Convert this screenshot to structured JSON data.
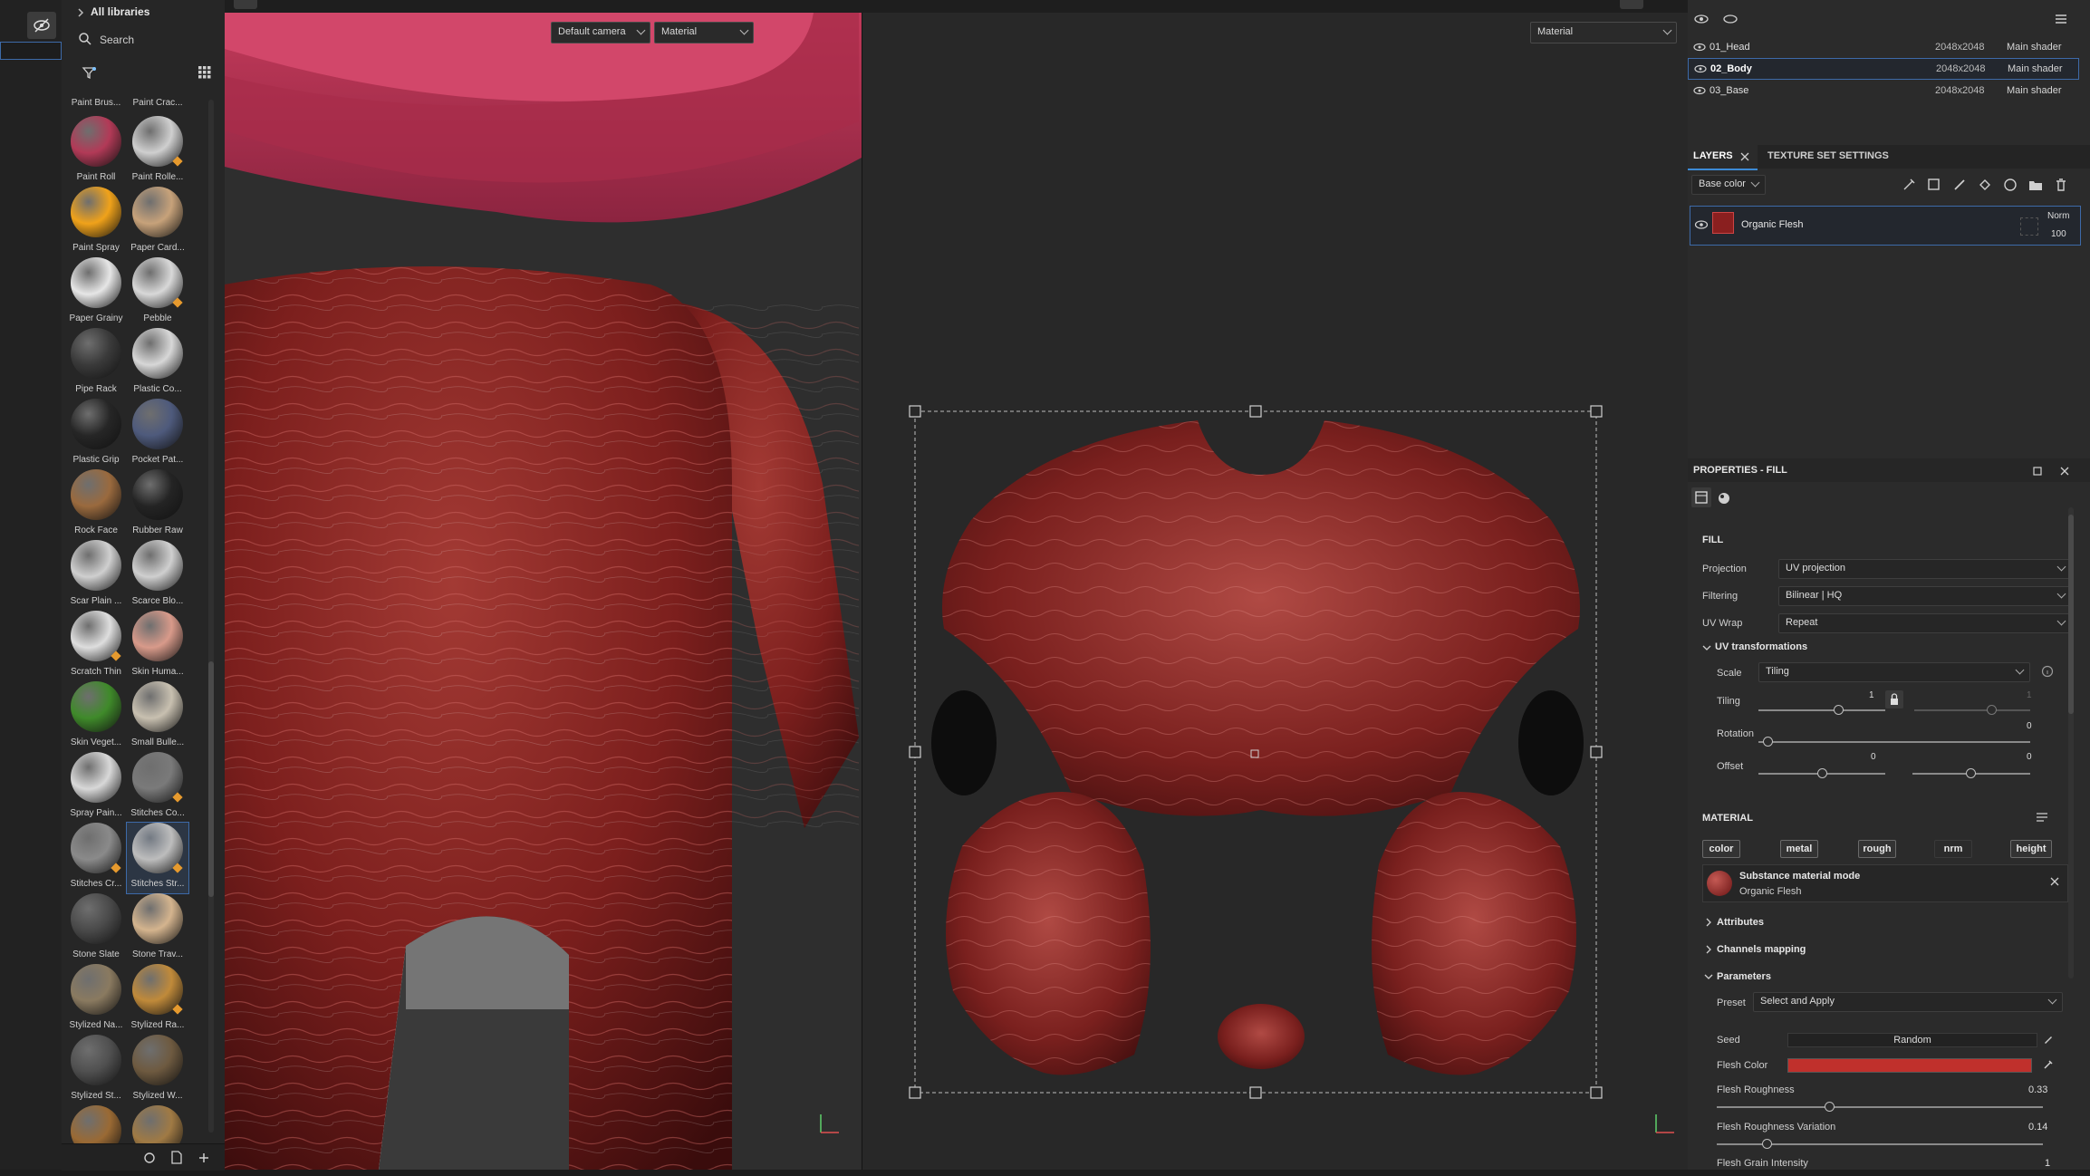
{
  "left_panel": {
    "toggle_icon": "hide-icon"
  },
  "shelf": {
    "breadcrumb": "All libraries",
    "search_placeholder": "Search",
    "top_labels": [
      "Paint Brus...",
      "Paint Crac..."
    ],
    "assets": [
      {
        "label": "Paint Roll",
        "color": "#b23a57"
      },
      {
        "label": "Paint Rolle...",
        "color": "#cfcfcf"
      },
      {
        "label": "Paint Spray",
        "color": "#f0a21a"
      },
      {
        "label": "Paper Card...",
        "color": "#c7a27a"
      },
      {
        "label": "Paper Grainy",
        "color": "#e6e6e6"
      },
      {
        "label": "Pebble",
        "color": "#d8d8d8"
      },
      {
        "label": "Pipe Rack",
        "color": "#3a3a3a"
      },
      {
        "label": "Plastic Co...",
        "color": "#d7d7d7"
      },
      {
        "label": "Plastic Grip",
        "color": "#262626"
      },
      {
        "label": "Pocket Pat...",
        "color": "#4e5a7c"
      },
      {
        "label": "Rock Face",
        "color": "#9a6a3e"
      },
      {
        "label": "Rubber Raw",
        "color": "#242424"
      },
      {
        "label": "Scar Plain ...",
        "color": "#cfcfcf"
      },
      {
        "label": "Scarce Blo...",
        "color": "#cfcfcf"
      },
      {
        "label": "Scratch Thin",
        "color": "#dedede"
      },
      {
        "label": "Skin Huma...",
        "color": "#d89a8a"
      },
      {
        "label": "Skin Veget...",
        "color": "#3f8a2a"
      },
      {
        "label": "Small Bulle...",
        "color": "#c8c0b0"
      },
      {
        "label": "Spray Pain...",
        "color": "#d8d8d8"
      },
      {
        "label": "Stitches Co...",
        "color": "#7a7a7a"
      },
      {
        "label": "Stitches Cr...",
        "color": "#8a8a8a"
      },
      {
        "label": "Stitches Str...",
        "color": "#bdbdbd"
      },
      {
        "label": "Stone Slate",
        "color": "#4a4a4a"
      },
      {
        "label": "Stone Trav...",
        "color": "#d4b48e"
      },
      {
        "label": "Stylized Na...",
        "color": "#8a7a60"
      },
      {
        "label": "Stylized Ra...",
        "color": "#c08a3a"
      },
      {
        "label": "Stylized St...",
        "color": "#505050"
      },
      {
        "label": "Stylized W...",
        "color": "#6e5a40"
      },
      {
        "label": "",
        "color": "#9a6a34"
      },
      {
        "label": "",
        "color": "#a07a44"
      }
    ]
  },
  "viewport3d": {
    "camera": "Default camera",
    "mode": "Material"
  },
  "viewport2d": {
    "mode": "Material"
  },
  "texture_sets": [
    {
      "name": "01_Head",
      "size": "2048x2048",
      "shader": "Main shader",
      "selected": false
    },
    {
      "name": "02_Body",
      "size": "2048x2048",
      "shader": "Main shader",
      "selected": true
    },
    {
      "name": "03_Base",
      "size": "2048x2048",
      "shader": "Main shader",
      "selected": false
    }
  ],
  "tabs": {
    "layers": "LAYERS",
    "texture_set_settings": "TEXTURE SET SETTINGS"
  },
  "layers_panel": {
    "channel": "Base color",
    "layer_name": "Organic Flesh",
    "blend_mode": "Norm",
    "opacity": "100"
  },
  "properties": {
    "title": "PROPERTIES - FILL",
    "fill_header": "FILL",
    "projection_label": "Projection",
    "projection_value": "UV projection",
    "filtering_label": "Filtering",
    "filtering_value": "Bilinear | HQ",
    "uvwrap_label": "UV Wrap",
    "uvwrap_value": "Repeat",
    "uv_transformations": "UV transformations",
    "scale_label": "Scale",
    "scale_value": "Tiling",
    "tiling_label": "Tiling",
    "tiling_value": "1",
    "tiling_value2": "1",
    "rotation_label": "Rotation",
    "rotation_value": "0",
    "offset_label": "Offset",
    "offset_x": "0",
    "offset_y": "0",
    "material_header": "MATERIAL",
    "channels": [
      "color",
      "metal",
      "rough",
      "nrm",
      "height"
    ],
    "substance_mode": "Substance material mode",
    "substance_name": "Organic Flesh",
    "attributes": "Attributes",
    "channels_mapping": "Channels mapping",
    "parameters": "Parameters",
    "preset_label": "Preset",
    "preset_value": "Select and Apply",
    "seed_label": "Seed",
    "seed_value": "Random",
    "flesh_color_label": "Flesh Color",
    "flesh_color": "#c0302c",
    "flesh_roughness_label": "Flesh Roughness",
    "flesh_roughness_value": "0.33",
    "flesh_roughness_var_label": "Flesh Roughness Variation",
    "flesh_roughness_var_value": "0.14",
    "flesh_grain_label": "Flesh Grain Intensity",
    "flesh_grain_value": "1"
  }
}
